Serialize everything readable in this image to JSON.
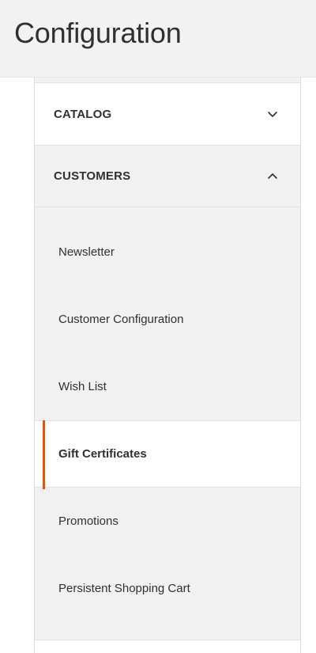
{
  "header": {
    "title": "Configuration"
  },
  "nav": {
    "sections": [
      {
        "label": "CATALOG",
        "expanded": false,
        "chevron_icon": "chevron-down-icon"
      },
      {
        "label": "CUSTOMERS",
        "expanded": true,
        "chevron_icon": "chevron-up-icon"
      }
    ],
    "customers_items": [
      {
        "label": "Newsletter",
        "active": false
      },
      {
        "label": "Customer Configuration",
        "active": false
      },
      {
        "label": "Wish List",
        "active": false
      },
      {
        "label": "Gift Certificates",
        "active": true
      },
      {
        "label": "Promotions",
        "active": false
      },
      {
        "label": "Persistent Shopping Cart",
        "active": false
      }
    ]
  },
  "colors": {
    "accent": "#eb5202",
    "text": "#303030",
    "panel_bg": "#f1f1f1",
    "header_bg": "#f2f2f2"
  }
}
